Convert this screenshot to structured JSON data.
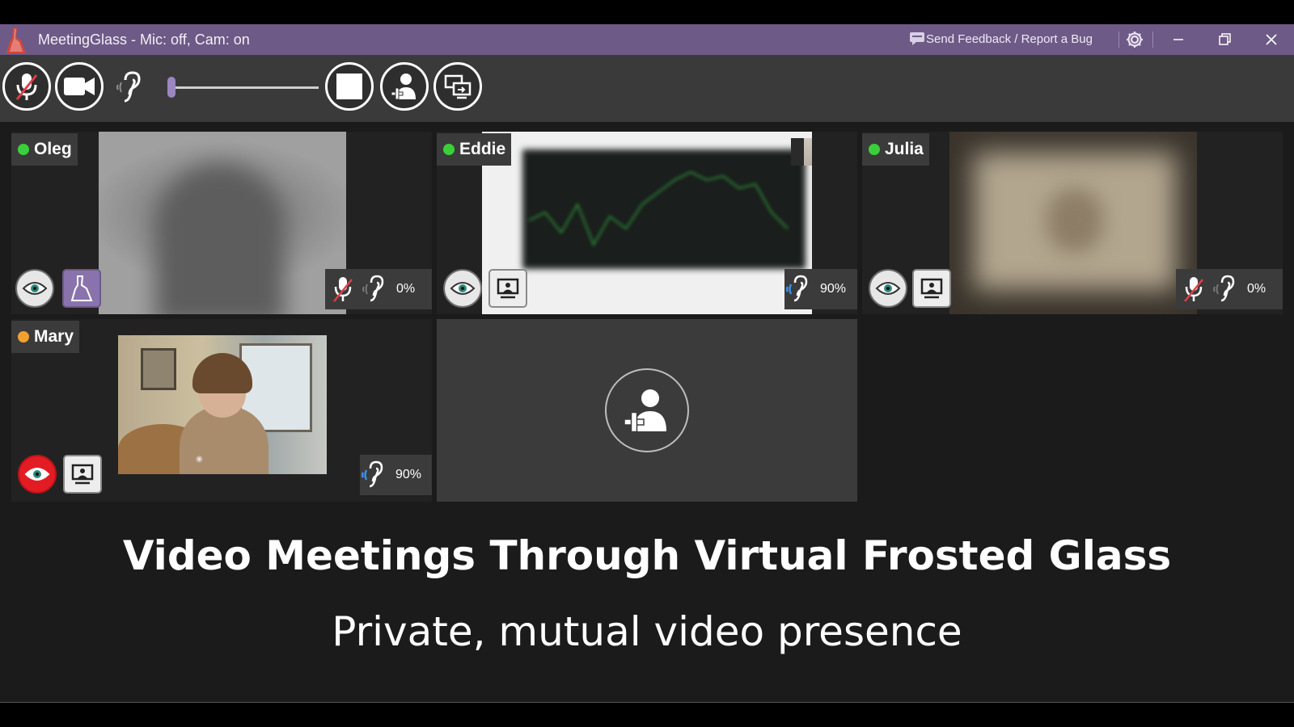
{
  "window": {
    "title": "MeetingGlass - Mic: off, Cam: on",
    "feedback_label": "Send Feedback / Report a Bug"
  },
  "toolbar": {
    "volume_level": 0.0
  },
  "participants": [
    {
      "name": "Oleg",
      "status_color": "#3ccf3c",
      "audio_level": "0%"
    },
    {
      "name": "Eddie",
      "status_color": "#3ccf3c",
      "audio_level": "90%"
    },
    {
      "name": "Julia",
      "status_color": "#3ccf3c",
      "audio_level": "0%"
    },
    {
      "name": "Mary",
      "status_color": "#f2a130",
      "audio_level": "90%"
    }
  ],
  "caption": {
    "headline": "Video Meetings Through Virtual Frosted Glass",
    "subheadline": "Private, mutual video presence"
  },
  "colors": {
    "titlebar": "#6e5a86",
    "accent": "#8a73ac",
    "alert": "#e31c23"
  },
  "icons": [
    "mic-off-icon",
    "camera-icon",
    "ear-icon",
    "stop-icon",
    "add-person-icon",
    "share-screen-icon",
    "eye-icon",
    "screen-share-icon",
    "gear-icon",
    "minimize-icon",
    "restore-icon",
    "close-icon",
    "feedback-icon"
  ]
}
